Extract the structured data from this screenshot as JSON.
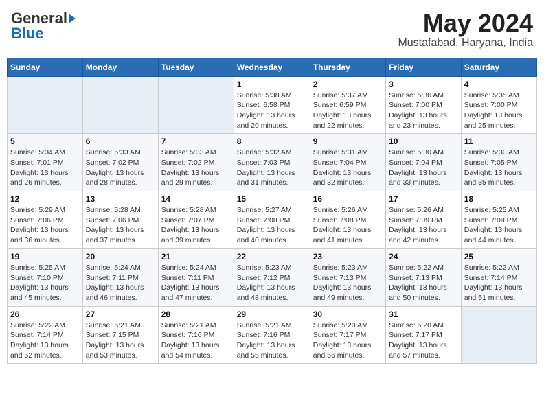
{
  "header": {
    "logo_general": "General",
    "logo_blue": "Blue",
    "title": "May 2024",
    "subtitle": "Mustafabad, Haryana, India"
  },
  "weekdays": [
    "Sunday",
    "Monday",
    "Tuesday",
    "Wednesday",
    "Thursday",
    "Friday",
    "Saturday"
  ],
  "weeks": [
    [
      {
        "day": "",
        "sunrise": "",
        "sunset": "",
        "daylight": ""
      },
      {
        "day": "",
        "sunrise": "",
        "sunset": "",
        "daylight": ""
      },
      {
        "day": "",
        "sunrise": "",
        "sunset": "",
        "daylight": ""
      },
      {
        "day": "1",
        "sunrise": "Sunrise: 5:38 AM",
        "sunset": "Sunset: 6:58 PM",
        "daylight": "Daylight: 13 hours and 20 minutes."
      },
      {
        "day": "2",
        "sunrise": "Sunrise: 5:37 AM",
        "sunset": "Sunset: 6:59 PM",
        "daylight": "Daylight: 13 hours and 22 minutes."
      },
      {
        "day": "3",
        "sunrise": "Sunrise: 5:36 AM",
        "sunset": "Sunset: 7:00 PM",
        "daylight": "Daylight: 13 hours and 23 minutes."
      },
      {
        "day": "4",
        "sunrise": "Sunrise: 5:35 AM",
        "sunset": "Sunset: 7:00 PM",
        "daylight": "Daylight: 13 hours and 25 minutes."
      }
    ],
    [
      {
        "day": "5",
        "sunrise": "Sunrise: 5:34 AM",
        "sunset": "Sunset: 7:01 PM",
        "daylight": "Daylight: 13 hours and 26 minutes."
      },
      {
        "day": "6",
        "sunrise": "Sunrise: 5:33 AM",
        "sunset": "Sunset: 7:02 PM",
        "daylight": "Daylight: 13 hours and 28 minutes."
      },
      {
        "day": "7",
        "sunrise": "Sunrise: 5:33 AM",
        "sunset": "Sunset: 7:02 PM",
        "daylight": "Daylight: 13 hours and 29 minutes."
      },
      {
        "day": "8",
        "sunrise": "Sunrise: 5:32 AM",
        "sunset": "Sunset: 7:03 PM",
        "daylight": "Daylight: 13 hours and 31 minutes."
      },
      {
        "day": "9",
        "sunrise": "Sunrise: 5:31 AM",
        "sunset": "Sunset: 7:04 PM",
        "daylight": "Daylight: 13 hours and 32 minutes."
      },
      {
        "day": "10",
        "sunrise": "Sunrise: 5:30 AM",
        "sunset": "Sunset: 7:04 PM",
        "daylight": "Daylight: 13 hours and 33 minutes."
      },
      {
        "day": "11",
        "sunrise": "Sunrise: 5:30 AM",
        "sunset": "Sunset: 7:05 PM",
        "daylight": "Daylight: 13 hours and 35 minutes."
      }
    ],
    [
      {
        "day": "12",
        "sunrise": "Sunrise: 5:29 AM",
        "sunset": "Sunset: 7:06 PM",
        "daylight": "Daylight: 13 hours and 36 minutes."
      },
      {
        "day": "13",
        "sunrise": "Sunrise: 5:28 AM",
        "sunset": "Sunset: 7:06 PM",
        "daylight": "Daylight: 13 hours and 37 minutes."
      },
      {
        "day": "14",
        "sunrise": "Sunrise: 5:28 AM",
        "sunset": "Sunset: 7:07 PM",
        "daylight": "Daylight: 13 hours and 39 minutes."
      },
      {
        "day": "15",
        "sunrise": "Sunrise: 5:27 AM",
        "sunset": "Sunset: 7:08 PM",
        "daylight": "Daylight: 13 hours and 40 minutes."
      },
      {
        "day": "16",
        "sunrise": "Sunrise: 5:26 AM",
        "sunset": "Sunset: 7:08 PM",
        "daylight": "Daylight: 13 hours and 41 minutes."
      },
      {
        "day": "17",
        "sunrise": "Sunrise: 5:26 AM",
        "sunset": "Sunset: 7:09 PM",
        "daylight": "Daylight: 13 hours and 42 minutes."
      },
      {
        "day": "18",
        "sunrise": "Sunrise: 5:25 AM",
        "sunset": "Sunset: 7:09 PM",
        "daylight": "Daylight: 13 hours and 44 minutes."
      }
    ],
    [
      {
        "day": "19",
        "sunrise": "Sunrise: 5:25 AM",
        "sunset": "Sunset: 7:10 PM",
        "daylight": "Daylight: 13 hours and 45 minutes."
      },
      {
        "day": "20",
        "sunrise": "Sunrise: 5:24 AM",
        "sunset": "Sunset: 7:11 PM",
        "daylight": "Daylight: 13 hours and 46 minutes."
      },
      {
        "day": "21",
        "sunrise": "Sunrise: 5:24 AM",
        "sunset": "Sunset: 7:11 PM",
        "daylight": "Daylight: 13 hours and 47 minutes."
      },
      {
        "day": "22",
        "sunrise": "Sunrise: 5:23 AM",
        "sunset": "Sunset: 7:12 PM",
        "daylight": "Daylight: 13 hours and 48 minutes."
      },
      {
        "day": "23",
        "sunrise": "Sunrise: 5:23 AM",
        "sunset": "Sunset: 7:13 PM",
        "daylight": "Daylight: 13 hours and 49 minutes."
      },
      {
        "day": "24",
        "sunrise": "Sunrise: 5:22 AM",
        "sunset": "Sunset: 7:13 PM",
        "daylight": "Daylight: 13 hours and 50 minutes."
      },
      {
        "day": "25",
        "sunrise": "Sunrise: 5:22 AM",
        "sunset": "Sunset: 7:14 PM",
        "daylight": "Daylight: 13 hours and 51 minutes."
      }
    ],
    [
      {
        "day": "26",
        "sunrise": "Sunrise: 5:22 AM",
        "sunset": "Sunset: 7:14 PM",
        "daylight": "Daylight: 13 hours and 52 minutes."
      },
      {
        "day": "27",
        "sunrise": "Sunrise: 5:21 AM",
        "sunset": "Sunset: 7:15 PM",
        "daylight": "Daylight: 13 hours and 53 minutes."
      },
      {
        "day": "28",
        "sunrise": "Sunrise: 5:21 AM",
        "sunset": "Sunset: 7:16 PM",
        "daylight": "Daylight: 13 hours and 54 minutes."
      },
      {
        "day": "29",
        "sunrise": "Sunrise: 5:21 AM",
        "sunset": "Sunset: 7:16 PM",
        "daylight": "Daylight: 13 hours and 55 minutes."
      },
      {
        "day": "30",
        "sunrise": "Sunrise: 5:20 AM",
        "sunset": "Sunset: 7:17 PM",
        "daylight": "Daylight: 13 hours and 56 minutes."
      },
      {
        "day": "31",
        "sunrise": "Sunrise: 5:20 AM",
        "sunset": "Sunset: 7:17 PM",
        "daylight": "Daylight: 13 hours and 57 minutes."
      },
      {
        "day": "",
        "sunrise": "",
        "sunset": "",
        "daylight": ""
      }
    ]
  ]
}
